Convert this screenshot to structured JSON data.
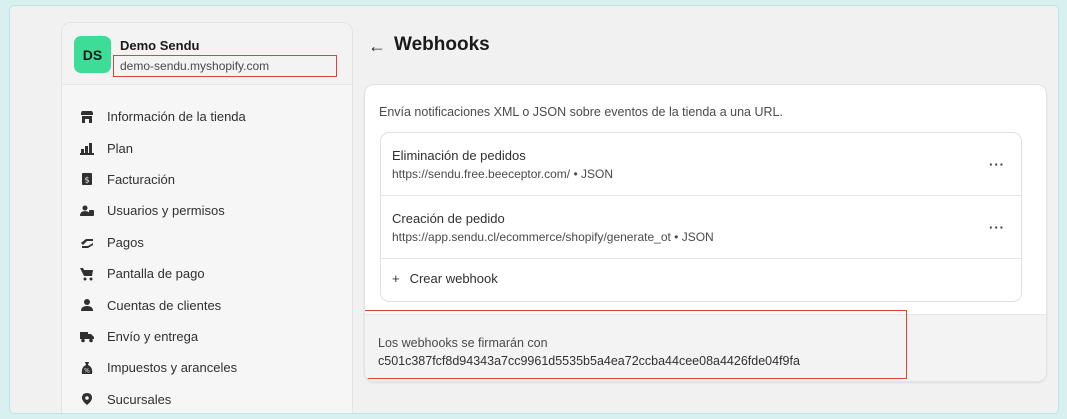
{
  "store": {
    "initials": "DS",
    "name": "Demo Sendu",
    "domain": "demo-sendu.myshopify.com"
  },
  "nav": [
    {
      "label": "Información de la tienda",
      "icon": "store-icon"
    },
    {
      "label": "Plan",
      "icon": "plan-chart-icon"
    },
    {
      "label": "Facturación",
      "icon": "billing-icon"
    },
    {
      "label": "Usuarios y permisos",
      "icon": "users-icon"
    },
    {
      "label": "Pagos",
      "icon": "payments-icon"
    },
    {
      "label": "Pantalla de pago",
      "icon": "cart-icon"
    },
    {
      "label": "Cuentas de clientes",
      "icon": "person-icon"
    },
    {
      "label": "Envío y entrega",
      "icon": "truck-icon"
    },
    {
      "label": "Impuestos y aranceles",
      "icon": "tax-icon"
    },
    {
      "label": "Sucursales",
      "icon": "location-pin-icon"
    }
  ],
  "page": {
    "back_arrow": "←",
    "title": "Webhooks"
  },
  "card": {
    "description": "Envía notificaciones XML o JSON sobre eventos de la tienda a una URL.",
    "webhooks": [
      {
        "title": "Eliminación de pedidos",
        "url": "https://sendu.free.beeceptor.com/ • JSON"
      },
      {
        "title": "Creación de pedido",
        "url": "https://app.sendu.cl/ecommerce/shopify/generate_ot • JSON"
      }
    ],
    "menu_glyph": "···",
    "create_plus": "+",
    "create_label": "Crear webhook",
    "signature_label": "Los webhooks se firmarán con",
    "signature_value": "c501c387fcf8d94343a7cc9961d5535b5a4ea72ccba44cee08a4426fde04f9fa"
  },
  "colors": {
    "avatar": "#3ddc97",
    "highlight_border": "#e0413b",
    "background": "#d8f1f0"
  }
}
